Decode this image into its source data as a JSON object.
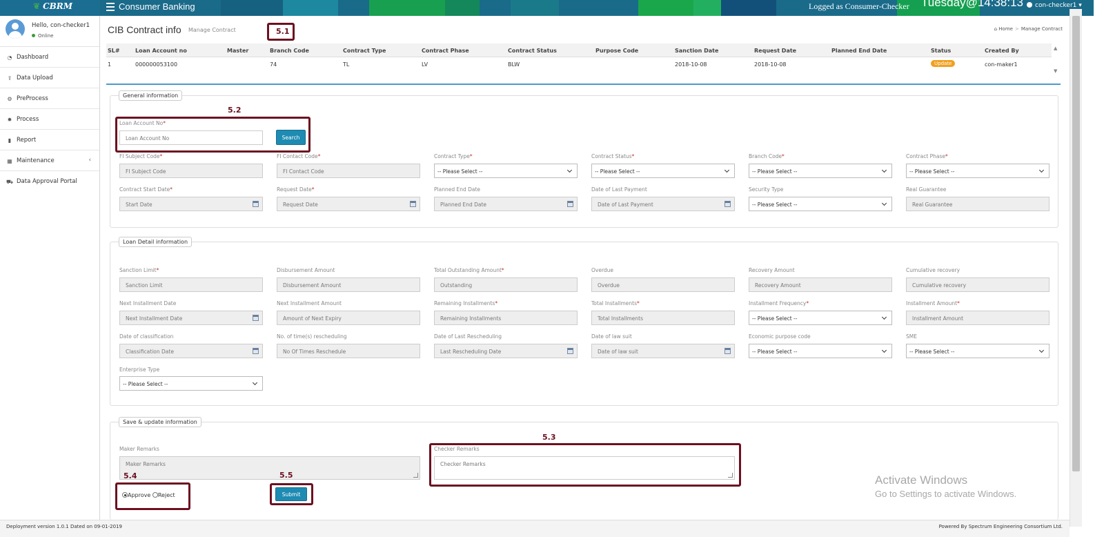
{
  "topbar": {
    "brand": "CBRM",
    "brand_icon": "leaf-logo-icon",
    "app_name": "Consumer Banking",
    "logged_as": "Logged as Consumer-Checker",
    "clock": "Tuesday@14:38:13",
    "user_menu": "con-checker1"
  },
  "sidebar": {
    "hello": "Hello, con-checker1",
    "status": "Online",
    "items": [
      {
        "label": "Dashboard",
        "icon": "dashboard-icon"
      },
      {
        "label": "Data Upload",
        "icon": "upload-icon"
      },
      {
        "label": "PreProcess",
        "icon": "cogs-icon"
      },
      {
        "label": "Process",
        "icon": "gear-icon"
      },
      {
        "label": "Report",
        "icon": "bar-chart-icon"
      },
      {
        "label": "Maintenance",
        "icon": "grid-icon"
      },
      {
        "label": "Data Approval Portal",
        "icon": "car-icon"
      }
    ]
  },
  "page": {
    "title": "CIB Contract info",
    "subtitle": "Manage Contract",
    "breadcrumb_home": "Home",
    "breadcrumb_current": "Manage Contract"
  },
  "annotations": {
    "a51": "5.1",
    "a52": "5.2",
    "a53": "5.3",
    "a54": "5.4",
    "a55": "5.5"
  },
  "table": {
    "headers": [
      "SL#",
      "Loan Account no",
      "Master",
      "Branch Code",
      "Contract Type",
      "Contract Phase",
      "Contract Status",
      "Purpose Code",
      "Sanction Date",
      "Request Date",
      "Planned End Date",
      "Status",
      "Created By"
    ],
    "row": {
      "sl": "1",
      "loan": "000000053100",
      "master": "",
      "branch": "74",
      "ctype": "TL",
      "cphase": "LV",
      "cstatus": "BLW",
      "purpose": "",
      "sanction": "2018-10-08",
      "request": "2018-10-08",
      "planned": "",
      "status": "Update",
      "created": "con-maker1"
    }
  },
  "general": {
    "legend": "General information",
    "loan_label": "Loan Account No",
    "loan_placeholder": "Loan Account No",
    "search": "Search",
    "fi_subject_label": "FI Subject Code",
    "fi_subject_ph": "FI Subject Code",
    "fi_contact_label": "FI Contact Code",
    "fi_contact_ph": "FI Contact Code",
    "ctype_label": "Contract Type",
    "cstatus_label": "Contract Status",
    "branch_label": "Branch Code",
    "cphase_label": "Contract Phase",
    "please": "-- Please Select --",
    "start_label": "Contract Start Date",
    "start_ph": "Start Date",
    "req_label": "Request Date",
    "req_ph": "Request Date",
    "planned_label": "Planned End Date",
    "planned_ph": "Planned End Date",
    "lastpay_label": "Date of Last Payment",
    "lastpay_ph": "Date of Last Payment",
    "security_label": "Security Type",
    "guarantee_label": "Real Guarantee",
    "guarantee_ph": "Real Guarantee"
  },
  "loan": {
    "legend": "Loan Detail information",
    "sanction_label": "Sanction Limit",
    "sanction_ph": "Sanction Limit",
    "disb_label": "Disbursement Amount",
    "disb_ph": "Disbursement Amount",
    "outstanding_label": "Total Outstanding Amount",
    "outstanding_ph": "Outstanding",
    "overdue_label": "Overdue",
    "overdue_ph": "Overdue",
    "recovery_label": "Recovery Amount",
    "recovery_ph": "Recovery Amount",
    "cumrec_label": "Cumulative recovery",
    "cumrec_ph": "Cumulative recovery",
    "nextdate_label": "Next Installment Date",
    "nextdate_ph": "Next Installment Date",
    "nextamt_label": "Next Installment Amount",
    "nextamt_ph": "Amount of Next Expiry",
    "remain_label": "Remaining Installments",
    "remain_ph": "Remaining Installments",
    "total_label": "Total Installments",
    "total_ph": "Total Installments",
    "freq_label": "Installment Frequency",
    "instamt_label": "Installment Amount",
    "instamt_ph": "Installment Amount",
    "class_label": "Date of classification",
    "class_ph": "Classification Date",
    "resched_label": "No. of time(s) rescheduling",
    "resched_ph": "No Of Times Reschedule",
    "lastres_label": "Date of Last Rescheduling",
    "lastres_ph": "Last Rescheduling Date",
    "lawsuit_label": "Date of law suit",
    "lawsuit_ph": "Date of law suit",
    "econ_label": "Economic purpose code",
    "sme_label": "SME",
    "enterprise_label": "Enterprise Type"
  },
  "save": {
    "legend": "Save & update information",
    "maker_label": "Maker Remarks",
    "maker_ph": "Maker Remarks",
    "checker_label": "Checker Remarks",
    "checker_ph": "Checker Remarks",
    "approve": "Approve",
    "reject": "Reject",
    "submit": "Submit"
  },
  "footer": {
    "left": "Deployment version 1.0.1 Dated on 09-01-2019",
    "right": "Powered By Spectrum Engineering Consortium Ltd."
  },
  "watermark": {
    "line1": "Activate Windows",
    "line2": "Go to Settings to activate Windows."
  },
  "colors": {
    "accent": "#1e8bb3",
    "annotation": "#6b1020",
    "badge": "#f0a020"
  }
}
